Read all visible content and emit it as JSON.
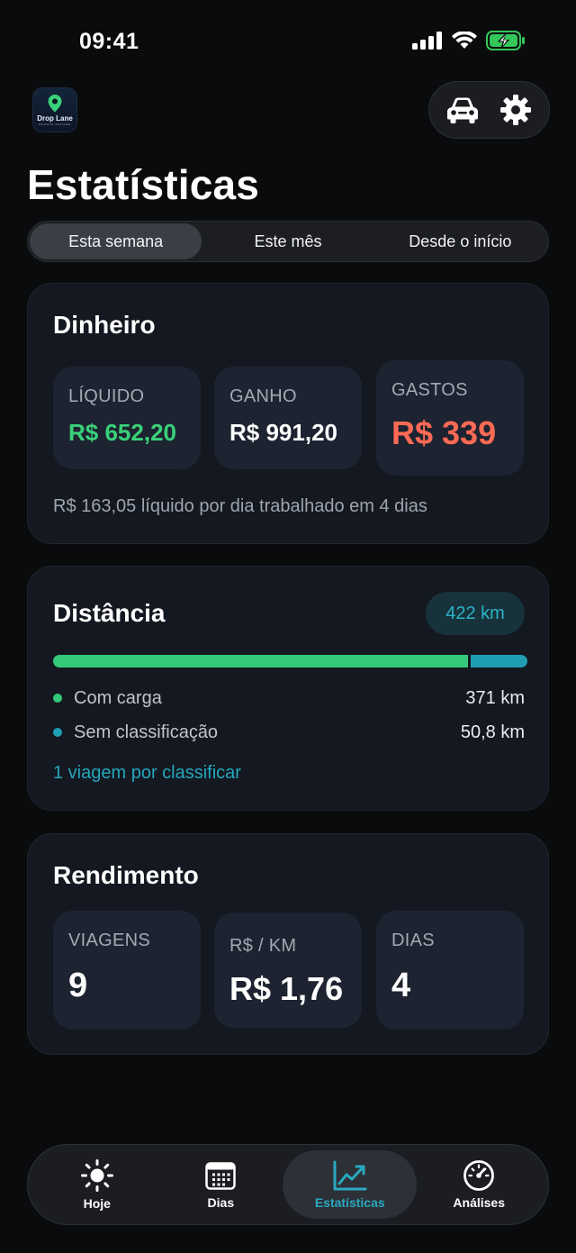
{
  "status_bar": {
    "time": "09:41"
  },
  "app": {
    "logo_text": "Drop Lane",
    "logo_sub": "MILEAGE TRACKER"
  },
  "header": {
    "title": "Estatísticas",
    "car_icon": "car-icon",
    "settings_icon": "gear-icon"
  },
  "period_tabs": [
    {
      "label": "Esta semana",
      "active": true
    },
    {
      "label": "Este mês",
      "active": false
    },
    {
      "label": "Desde o início",
      "active": false
    }
  ],
  "money": {
    "title": "Dinheiro",
    "net_label": "LÍQUIDO",
    "net_value": "R$ 652,20",
    "earned_label": "GANHO",
    "earned_value": "R$ 991,20",
    "expenses_label": "GASTOS",
    "expenses_value": "R$ 339",
    "note": "R$ 163,05 líquido por dia trabalhado em 4 dias"
  },
  "distance": {
    "title": "Distância",
    "total": "422 km",
    "loaded_label": "Com carga",
    "loaded_value": "371 km",
    "loaded_km": 371,
    "unclassified_label": "Sem classificação",
    "unclassified_value": "50,8 km",
    "unclassified_km": 50.8,
    "classify_link": "1 viagem por classificar"
  },
  "performance": {
    "title": "Rendimento",
    "trips_label": "VIAGENS",
    "trips_value": "9",
    "per_km_label": "R$ / KM",
    "per_km_value": "R$ 1,76",
    "days_label": "DIAS",
    "days_value": "4"
  },
  "tab_bar": [
    {
      "label": "Hoje",
      "icon": "sun-icon",
      "active": false
    },
    {
      "label": "Dias",
      "icon": "calendar-icon",
      "active": false
    },
    {
      "label": "Estatísticas",
      "icon": "chart-icon",
      "active": true
    },
    {
      "label": "Análises",
      "icon": "speedometer-icon",
      "active": false
    }
  ],
  "colors": {
    "accent_teal": "#2aa9c0",
    "positive_green": "#3ad17a",
    "negative_red": "#ff6a55",
    "battery_green": "#34c759"
  }
}
